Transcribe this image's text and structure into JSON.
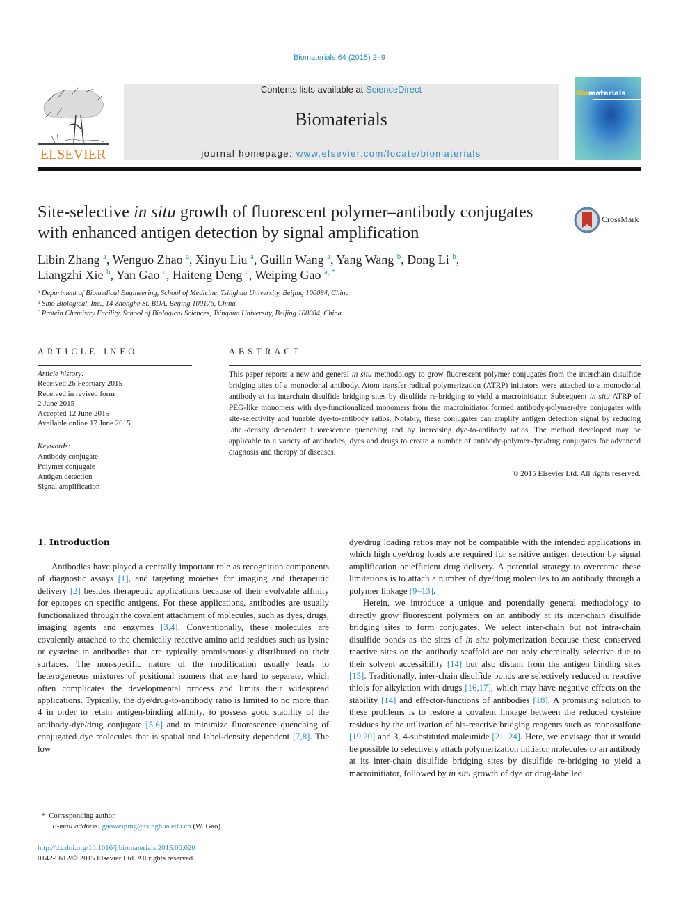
{
  "header": {
    "journal_ref": "Biomaterials 64 (2015) 2–9",
    "contents_prefix": "Contents lists available at ",
    "contents_link": "ScienceDirect",
    "journal_title": "Biomaterials",
    "homepage_prefix": "journal homepage: ",
    "homepage_link": "www.elsevier.com/locate/biomaterials",
    "publisher_logo_text": "ELSEVIER",
    "cover_title_highlight": "Bio",
    "cover_title_rest": "materials",
    "crossmark_label": "CrossMark"
  },
  "colors": {
    "link": "#2a8fbd",
    "elsevier_orange": "#f07d1a",
    "header_box": "#e8e8e8"
  },
  "article": {
    "title_part1": "Site-selective ",
    "title_italic": "in situ",
    "title_part2": " growth of fluorescent polymer–antibody conjugates with enhanced antigen detection by signal amplification",
    "authors": [
      {
        "name": "Libin Zhang",
        "aff": "a",
        "sep": ", "
      },
      {
        "name": "Wenguo Zhao",
        "aff": "a",
        "sep": ", "
      },
      {
        "name": "Xinyu Liu",
        "aff": "a",
        "sep": ", "
      },
      {
        "name": "Guilin Wang",
        "aff": "a",
        "sep": ", "
      },
      {
        "name": "Yang Wang",
        "aff": "b",
        "sep": ", "
      },
      {
        "name": "Dong Li",
        "aff": "b",
        "sep": ","
      },
      {
        "name": "Liangzhi Xie",
        "aff": "b",
        "sep": ", "
      },
      {
        "name": "Yan Gao",
        "aff": "c",
        "sep": ", "
      },
      {
        "name": "Haiteng Deng",
        "aff": "c",
        "sep": ", "
      },
      {
        "name": "Weiping Gao",
        "aff": "a, *",
        "sep": ""
      }
    ],
    "affiliations": [
      {
        "key": "a",
        "text": "Department of Biomedical Engineering, School of Medicine, Tsinghua University, Beijing 100084, China"
      },
      {
        "key": "b",
        "text": "Sino Biological, Inc., 14 Zhonghe St. BDA, Beijing 100176, China"
      },
      {
        "key": "c",
        "text": "Protein Chemistry Facility, School of Biological Sciences, Tsinghua University, Beijing 100084, China"
      }
    ]
  },
  "article_info": {
    "heading": "ARTICLE INFO",
    "history_label": "Article history:",
    "history": [
      "Received 26 February 2015",
      "Received in revised form",
      "2 June 2015",
      "Accepted 12 June 2015",
      "Available online 17 June 2015"
    ],
    "keywords_label": "Keywords:",
    "keywords": [
      "Antibody conjugate",
      "Polymer conjugate",
      "Antigen detection",
      "Signal amplification"
    ]
  },
  "abstract": {
    "heading": "ABSTRACT",
    "s1": "This paper reports a new and general ",
    "s1_it": "in situ",
    "s2": " methodology to grow fluorescent polymer conjugates from the interchain disulfide bridging sites of a monoclonal antibody. Atom transfer radical polymerization (ATRP) initiators were attached to a monoclonal antibody at its interchain disulfide bridging sites by disulfide re-bridging to yield a macroinitiator. Subsequent ",
    "s2_it": "in situ",
    "s3": " ATRP of PEG-like monomers with dye-functionalized monomers from the macroinitiator formed antibody-polymer-dye conjugates with site-selectivity and tunable dye-to-antibody ratios. Notably, these conjugates can amplify antigen detection signal by reducing label-density dependent fluorescence quenching and by increasing dye-to-antibody ratios. The method developed may be applicable to a variety of antibodies, dyes and drugs to create a number of antibody-polymer-dye/drug conjugates for advanced diagnosis and therapy of diseases.",
    "copyright": "© 2015 Elsevier Ltd. All rights reserved."
  },
  "body": {
    "section_heading": "1.  Introduction",
    "left": {
      "t1": "Antibodies have played a centrally important role as recognition components of diagnostic assays ",
      "r1": "[1]",
      "t2": ", and targeting moieties for imaging and therapeutic delivery ",
      "r2": "[2]",
      "t3": " besides therapeutic applications because of their evolvable affinity for epitopes on specific antigens. For these applications, antibodies are usually functionalized through the covalent attachment of molecules, such as dyes, drugs, imaging agents and enzymes ",
      "r3": "[3,4]",
      "t4": ". Conventionally, these molecules are covalently attached to the chemically reactive amino acid residues such as lysine or cysteine in antibodies that are typically promiscuously distributed on their surfaces. The non-specific nature of the modification usually leads to heterogeneous mixtures of positional isomers that are hard to separate, which often complicates the developmental process and limits their widespread applications. Typically, the dye/drug-to-antibody ratio is limited to no more than 4 in order to retain antigen-binding affinity, to possess good stability of the antibody-dye/drug conjugate ",
      "r4": "[5,6]",
      "t5": " and to minimize fluorescence quenching of conjugated dye molecules that is spatial and label-density dependent ",
      "r5": "[7,8]",
      "t6": ". The low"
    },
    "right": {
      "p1_t1": "dye/drug loading ratios may not be compatible with the intended applications in which high dye/drug loads are required for sensitive antigen detection by signal amplification or efficient drug delivery. A potential strategy to overcome these limitations is to attach a number of dye/drug molecules to an antibody through a polymer linkage ",
      "p1_r1": "[9–13]",
      "p1_t2": ".",
      "p2_t1": "Herein, we introduce a unique and potentially general methodology to directly grow fluorescent polymers on an antibody at its inter-chain disulfide bridging sites to form conjugates. We select inter-chain but not intra-chain disulfide bonds as the sites of ",
      "p2_it1": "in situ",
      "p2_t2": " polymerization because these conserved reactive sites on the antibody scaffold are not only chemically selective due to their solvent accessibility ",
      "p2_r1": "[14]",
      "p2_t3": " but also distant from the antigen binding sites ",
      "p2_r2": "[15]",
      "p2_t4": ". Traditionally, inter-chain disulfide bonds are selectively reduced to reactive thiols for alkylation with drugs ",
      "p2_r3": "[16,17]",
      "p2_t5": ", which may have negative effects on the stability ",
      "p2_r4": "[14]",
      "p2_t6": " and effector-functions of antibodies ",
      "p2_r5": "[18]",
      "p2_t7": ". A promising solution to these problems is to restore a covalent linkage between the reduced cysteine residues by the utilization of bis-reactive bridging reagents such as monosulfone ",
      "p2_r6": "[19,20]",
      "p2_t8": " and 3, 4-substituted maleimide ",
      "p2_r7": "[21–24]",
      "p2_t9": ". Here, we envisage that it would be possible to selectively attach polymerization initiator molecules to an antibody at its inter-chain disulfide bridging sites by disulfide re-bridging to yield a macroinitiator, followed by ",
      "p2_it2": "in situ",
      "p2_t10": " growth of dye or drug-labelled"
    }
  },
  "footnotes": {
    "star": "*",
    "corresponding": "Corresponding author.",
    "email_label": "E-mail address:",
    "email": "gaoweiping@tsinghua.edu.cn",
    "email_suffix": " (W. Gao).",
    "doi_link": "http://dx.doi.org/10.1016/j.biomaterials.2015.06.020",
    "issn_line": "0142-9612/© 2015 Elsevier Ltd. All rights reserved."
  }
}
